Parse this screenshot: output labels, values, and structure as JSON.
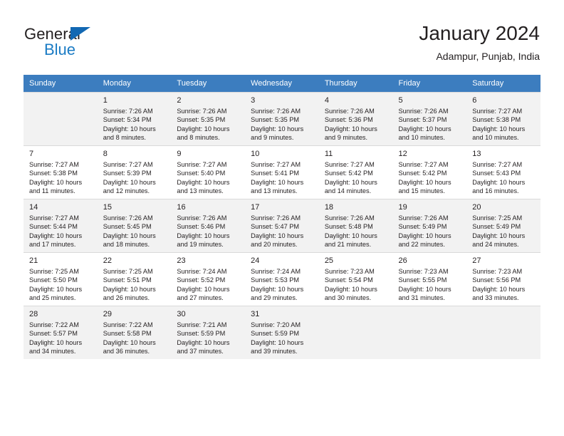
{
  "brand": {
    "name_part1": "General",
    "name_part2": "Blue",
    "triangle_color": "#1268b3",
    "blue_text_color": "#1a7bc4"
  },
  "header": {
    "title": "January 2024",
    "subtitle": "Adampur, Punjab, India"
  },
  "theme": {
    "header_row_bg": "#3c7dbf",
    "header_row_text": "#ffffff",
    "shaded_row_bg": "#f2f2f2",
    "text_color": "#231f20"
  },
  "weekdays": [
    "Sunday",
    "Monday",
    "Tuesday",
    "Wednesday",
    "Thursday",
    "Friday",
    "Saturday"
  ],
  "labels": {
    "sunrise_prefix": "Sunrise:",
    "sunset_prefix": "Sunset:",
    "daylight_prefix": "Daylight:"
  },
  "weeks": [
    [
      {
        "day": "",
        "l1": "",
        "l2": "",
        "l3": "",
        "l4": ""
      },
      {
        "day": "1",
        "l1": "Sunrise: 7:26 AM",
        "l2": "Sunset: 5:34 PM",
        "l3": "Daylight: 10 hours",
        "l4": "and 8 minutes."
      },
      {
        "day": "2",
        "l1": "Sunrise: 7:26 AM",
        "l2": "Sunset: 5:35 PM",
        "l3": "Daylight: 10 hours",
        "l4": "and 8 minutes."
      },
      {
        "day": "3",
        "l1": "Sunrise: 7:26 AM",
        "l2": "Sunset: 5:35 PM",
        "l3": "Daylight: 10 hours",
        "l4": "and 9 minutes."
      },
      {
        "day": "4",
        "l1": "Sunrise: 7:26 AM",
        "l2": "Sunset: 5:36 PM",
        "l3": "Daylight: 10 hours",
        "l4": "and 9 minutes."
      },
      {
        "day": "5",
        "l1": "Sunrise: 7:26 AM",
        "l2": "Sunset: 5:37 PM",
        "l3": "Daylight: 10 hours",
        "l4": "and 10 minutes."
      },
      {
        "day": "6",
        "l1": "Sunrise: 7:27 AM",
        "l2": "Sunset: 5:38 PM",
        "l3": "Daylight: 10 hours",
        "l4": "and 10 minutes."
      }
    ],
    [
      {
        "day": "7",
        "l1": "Sunrise: 7:27 AM",
        "l2": "Sunset: 5:38 PM",
        "l3": "Daylight: 10 hours",
        "l4": "and 11 minutes."
      },
      {
        "day": "8",
        "l1": "Sunrise: 7:27 AM",
        "l2": "Sunset: 5:39 PM",
        "l3": "Daylight: 10 hours",
        "l4": "and 12 minutes."
      },
      {
        "day": "9",
        "l1": "Sunrise: 7:27 AM",
        "l2": "Sunset: 5:40 PM",
        "l3": "Daylight: 10 hours",
        "l4": "and 13 minutes."
      },
      {
        "day": "10",
        "l1": "Sunrise: 7:27 AM",
        "l2": "Sunset: 5:41 PM",
        "l3": "Daylight: 10 hours",
        "l4": "and 13 minutes."
      },
      {
        "day": "11",
        "l1": "Sunrise: 7:27 AM",
        "l2": "Sunset: 5:42 PM",
        "l3": "Daylight: 10 hours",
        "l4": "and 14 minutes."
      },
      {
        "day": "12",
        "l1": "Sunrise: 7:27 AM",
        "l2": "Sunset: 5:42 PM",
        "l3": "Daylight: 10 hours",
        "l4": "and 15 minutes."
      },
      {
        "day": "13",
        "l1": "Sunrise: 7:27 AM",
        "l2": "Sunset: 5:43 PM",
        "l3": "Daylight: 10 hours",
        "l4": "and 16 minutes."
      }
    ],
    [
      {
        "day": "14",
        "l1": "Sunrise: 7:27 AM",
        "l2": "Sunset: 5:44 PM",
        "l3": "Daylight: 10 hours",
        "l4": "and 17 minutes."
      },
      {
        "day": "15",
        "l1": "Sunrise: 7:26 AM",
        "l2": "Sunset: 5:45 PM",
        "l3": "Daylight: 10 hours",
        "l4": "and 18 minutes."
      },
      {
        "day": "16",
        "l1": "Sunrise: 7:26 AM",
        "l2": "Sunset: 5:46 PM",
        "l3": "Daylight: 10 hours",
        "l4": "and 19 minutes."
      },
      {
        "day": "17",
        "l1": "Sunrise: 7:26 AM",
        "l2": "Sunset: 5:47 PM",
        "l3": "Daylight: 10 hours",
        "l4": "and 20 minutes."
      },
      {
        "day": "18",
        "l1": "Sunrise: 7:26 AM",
        "l2": "Sunset: 5:48 PM",
        "l3": "Daylight: 10 hours",
        "l4": "and 21 minutes."
      },
      {
        "day": "19",
        "l1": "Sunrise: 7:26 AM",
        "l2": "Sunset: 5:49 PM",
        "l3": "Daylight: 10 hours",
        "l4": "and 22 minutes."
      },
      {
        "day": "20",
        "l1": "Sunrise: 7:25 AM",
        "l2": "Sunset: 5:49 PM",
        "l3": "Daylight: 10 hours",
        "l4": "and 24 minutes."
      }
    ],
    [
      {
        "day": "21",
        "l1": "Sunrise: 7:25 AM",
        "l2": "Sunset: 5:50 PM",
        "l3": "Daylight: 10 hours",
        "l4": "and 25 minutes."
      },
      {
        "day": "22",
        "l1": "Sunrise: 7:25 AM",
        "l2": "Sunset: 5:51 PM",
        "l3": "Daylight: 10 hours",
        "l4": "and 26 minutes."
      },
      {
        "day": "23",
        "l1": "Sunrise: 7:24 AM",
        "l2": "Sunset: 5:52 PM",
        "l3": "Daylight: 10 hours",
        "l4": "and 27 minutes."
      },
      {
        "day": "24",
        "l1": "Sunrise: 7:24 AM",
        "l2": "Sunset: 5:53 PM",
        "l3": "Daylight: 10 hours",
        "l4": "and 29 minutes."
      },
      {
        "day": "25",
        "l1": "Sunrise: 7:23 AM",
        "l2": "Sunset: 5:54 PM",
        "l3": "Daylight: 10 hours",
        "l4": "and 30 minutes."
      },
      {
        "day": "26",
        "l1": "Sunrise: 7:23 AM",
        "l2": "Sunset: 5:55 PM",
        "l3": "Daylight: 10 hours",
        "l4": "and 31 minutes."
      },
      {
        "day": "27",
        "l1": "Sunrise: 7:23 AM",
        "l2": "Sunset: 5:56 PM",
        "l3": "Daylight: 10 hours",
        "l4": "and 33 minutes."
      }
    ],
    [
      {
        "day": "28",
        "l1": "Sunrise: 7:22 AM",
        "l2": "Sunset: 5:57 PM",
        "l3": "Daylight: 10 hours",
        "l4": "and 34 minutes."
      },
      {
        "day": "29",
        "l1": "Sunrise: 7:22 AM",
        "l2": "Sunset: 5:58 PM",
        "l3": "Daylight: 10 hours",
        "l4": "and 36 minutes."
      },
      {
        "day": "30",
        "l1": "Sunrise: 7:21 AM",
        "l2": "Sunset: 5:59 PM",
        "l3": "Daylight: 10 hours",
        "l4": "and 37 minutes."
      },
      {
        "day": "31",
        "l1": "Sunrise: 7:20 AM",
        "l2": "Sunset: 5:59 PM",
        "l3": "Daylight: 10 hours",
        "l4": "and 39 minutes."
      },
      {
        "day": "",
        "l1": "",
        "l2": "",
        "l3": "",
        "l4": ""
      },
      {
        "day": "",
        "l1": "",
        "l2": "",
        "l3": "",
        "l4": ""
      },
      {
        "day": "",
        "l1": "",
        "l2": "",
        "l3": "",
        "l4": ""
      }
    ]
  ]
}
